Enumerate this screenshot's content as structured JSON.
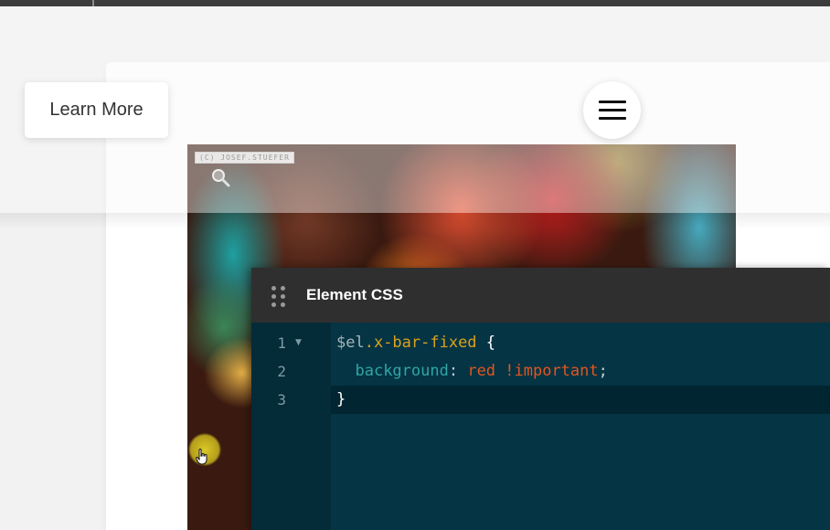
{
  "header": {
    "learn_more_label": "Learn More",
    "menu_icon": "hamburger-icon"
  },
  "hero": {
    "watermark": "(C) JOSEF.STUEFER",
    "zoom_icon": "magnifier-icon"
  },
  "css_panel": {
    "title": "Element CSS",
    "drag_icon": "drag-handle-icon",
    "line_numbers": [
      "1",
      "2",
      "3"
    ],
    "code": {
      "line1": {
        "var": "$el",
        "selector": ".x-bar-fixed",
        "brace": " {"
      },
      "line2": {
        "indent": "  ",
        "property": "background",
        "colon": ": ",
        "value": "red !important",
        "semicolon": ";"
      },
      "line3": {
        "brace": "}"
      }
    }
  },
  "colors": {
    "panel_bg": "#053444",
    "panel_header": "#2f2f2f",
    "selector": "#d9a21b",
    "property": "#2fa6a4",
    "value": "#e0561f"
  },
  "cursor_icon": "pointer-hand-icon"
}
